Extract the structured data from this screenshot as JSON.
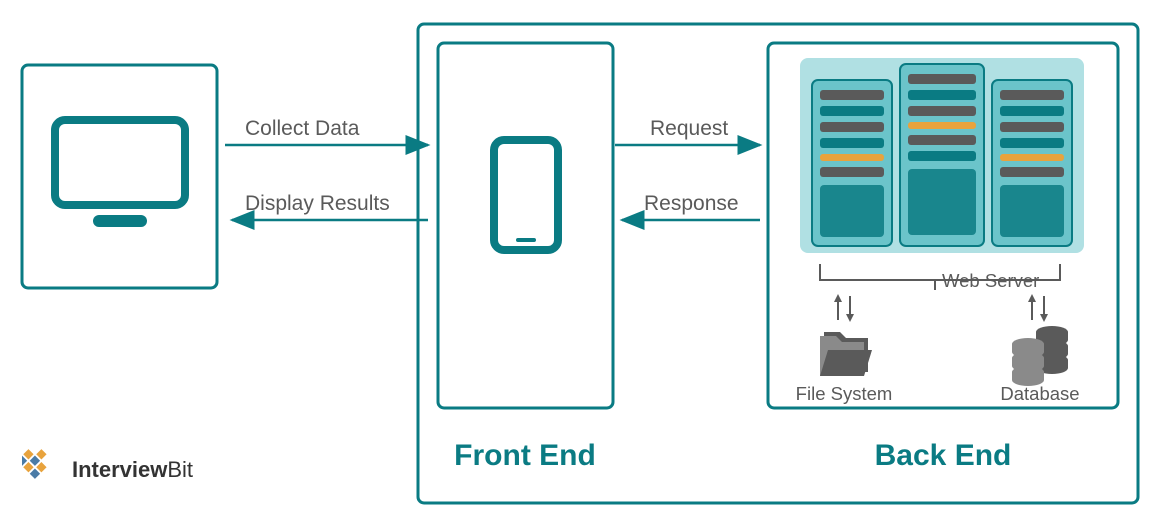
{
  "arrows": {
    "collect": "Collect Data",
    "display": "Display Results",
    "request": "Request",
    "response": "Response"
  },
  "sections": {
    "front": "Front End",
    "back": "Back End"
  },
  "backend": {
    "webserver": "Web Server",
    "filesystem": "File System",
    "database": "Database"
  },
  "brand": {
    "bold": "Interview",
    "rest": "Bit"
  }
}
